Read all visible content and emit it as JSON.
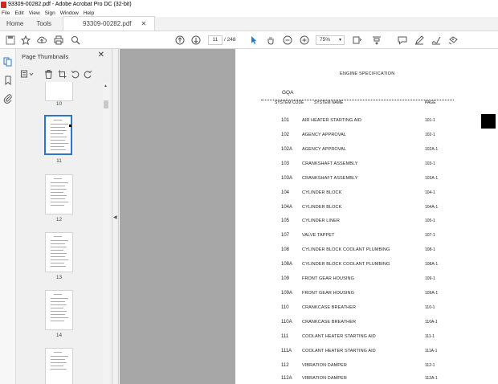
{
  "window": {
    "title": "93309-00282.pdf - Adobe Acrobat Pro DC (32-bit)"
  },
  "menu": [
    "File",
    "Edit",
    "View",
    "Sign",
    "Window",
    "Help"
  ],
  "tabs": {
    "home": "Home",
    "tools": "Tools",
    "document": "93309-00282.pdf"
  },
  "toolbar": {
    "page_current": "11",
    "page_total": "/ 248",
    "zoom": "75%"
  },
  "panel": {
    "title": "Page Thumbnails"
  },
  "thumbnails": [
    "10",
    "11",
    "12",
    "13",
    "14"
  ],
  "document": {
    "title": "ENGINE SPECIFICATION",
    "group": "GQA",
    "headers": {
      "code": "SYSTEM CODE",
      "name": "SYSTEM NAME",
      "page": "PAGE"
    },
    "rows": [
      {
        "code": "101",
        "name": "AIR HEATER STARTING AID",
        "page": "101-1"
      },
      {
        "code": "102",
        "name": "AGENCY APPROVAL",
        "page": "102-1"
      },
      {
        "code": "102A",
        "name": "AGENCY APPROVAL",
        "page": "102A-1"
      },
      {
        "code": "103",
        "name": "CRANKSHAFT ASSEMBLY",
        "page": "103-1"
      },
      {
        "code": "103A",
        "name": "CRANKSHAFT ASSEMBLY",
        "page": "103A-1"
      },
      {
        "code": "104",
        "name": "CYLINDER BLOCK",
        "page": "104-1"
      },
      {
        "code": "104A",
        "name": "CYLINDER BLOCK",
        "page": "104A-1"
      },
      {
        "code": "105",
        "name": "CYLINDER LINER",
        "page": "105-1"
      },
      {
        "code": "107",
        "name": "VALVE TAPPET",
        "page": "107-1"
      },
      {
        "code": "108",
        "name": "CYLINDER BLOCK COOLANT PLUMBING",
        "page": "108-1"
      },
      {
        "code": "108A",
        "name": "CYLINDER BLOCK COOLANT PLUMBING",
        "page": "108A-1"
      },
      {
        "code": "109",
        "name": "FRONT GEAR HOUSING",
        "page": "109-1"
      },
      {
        "code": "109A",
        "name": "FRONT GEAR HOUSING",
        "page": "109A-1"
      },
      {
        "code": "110",
        "name": "CRANKCASE BREATHER",
        "page": "110-1"
      },
      {
        "code": "110A",
        "name": "CRANKCASE BREATHER",
        "page": "110A-1"
      },
      {
        "code": "111",
        "name": "COOLANT HEATER STARTING AID",
        "page": "111-1"
      },
      {
        "code": "111A",
        "name": "COOLANT HEATER STARTING AID",
        "page": "111A-1"
      },
      {
        "code": "112",
        "name": "VIBRATION DAMPER",
        "page": "112-1"
      },
      {
        "code": "112A",
        "name": "VIBRATION DAMPER",
        "page": "112A-1"
      }
    ]
  }
}
